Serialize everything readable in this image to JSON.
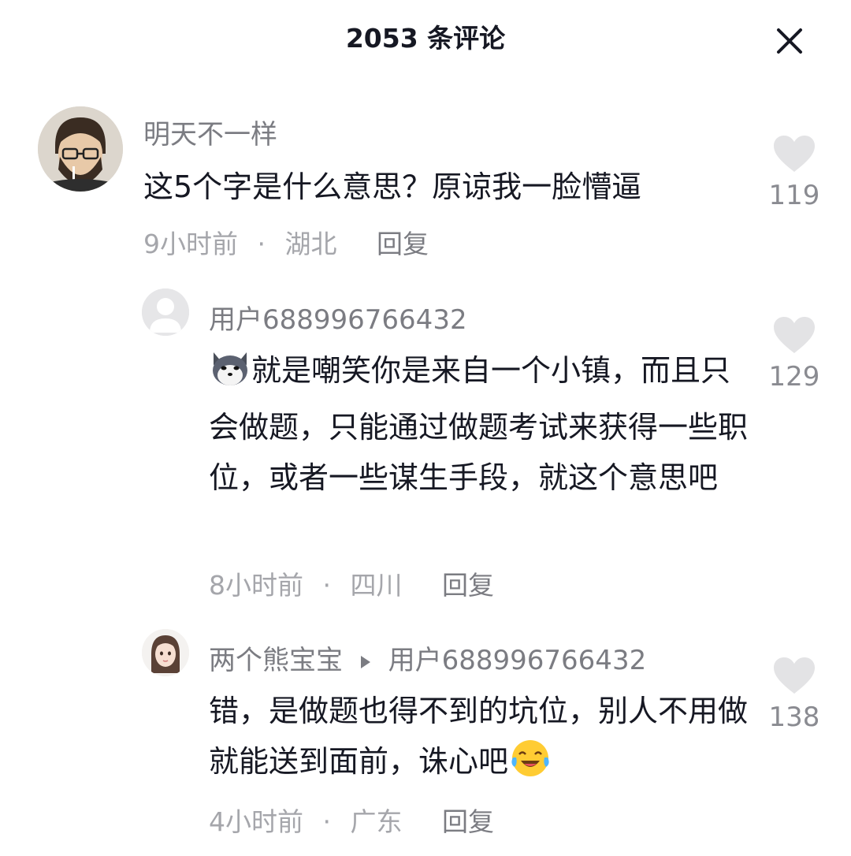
{
  "header": {
    "title": "2053 条评论"
  },
  "comments": [
    {
      "username": "明天不一样",
      "text": "这5个字是什么意思？原谅我一脸懵逼",
      "time": "9小时前",
      "location": "湖北",
      "reply_label": "回复",
      "likes": "119"
    },
    {
      "username": "用户688996766432",
      "text": "就是嘲笑你是来自一个小镇，而且只会做题，只能通过做题考试来获得一些职位，或者一些谋生手段，就这个意思吧",
      "time": "8小时前",
      "location": "四川",
      "reply_label": "回复",
      "likes": "129"
    },
    {
      "username": "两个熊宝宝",
      "reply_to": "用户688996766432",
      "text": "错，是做题也得不到的坑位，别人不用做就能送到面前，诛心吧",
      "time": "4小时前",
      "location": "广东",
      "reply_label": "回复",
      "likes": "138"
    }
  ],
  "separator": "·",
  "colors": {
    "text": "#161823",
    "name": "#7b7c82",
    "meta": "#a5a6ab",
    "heart": "#e3e3e5"
  }
}
